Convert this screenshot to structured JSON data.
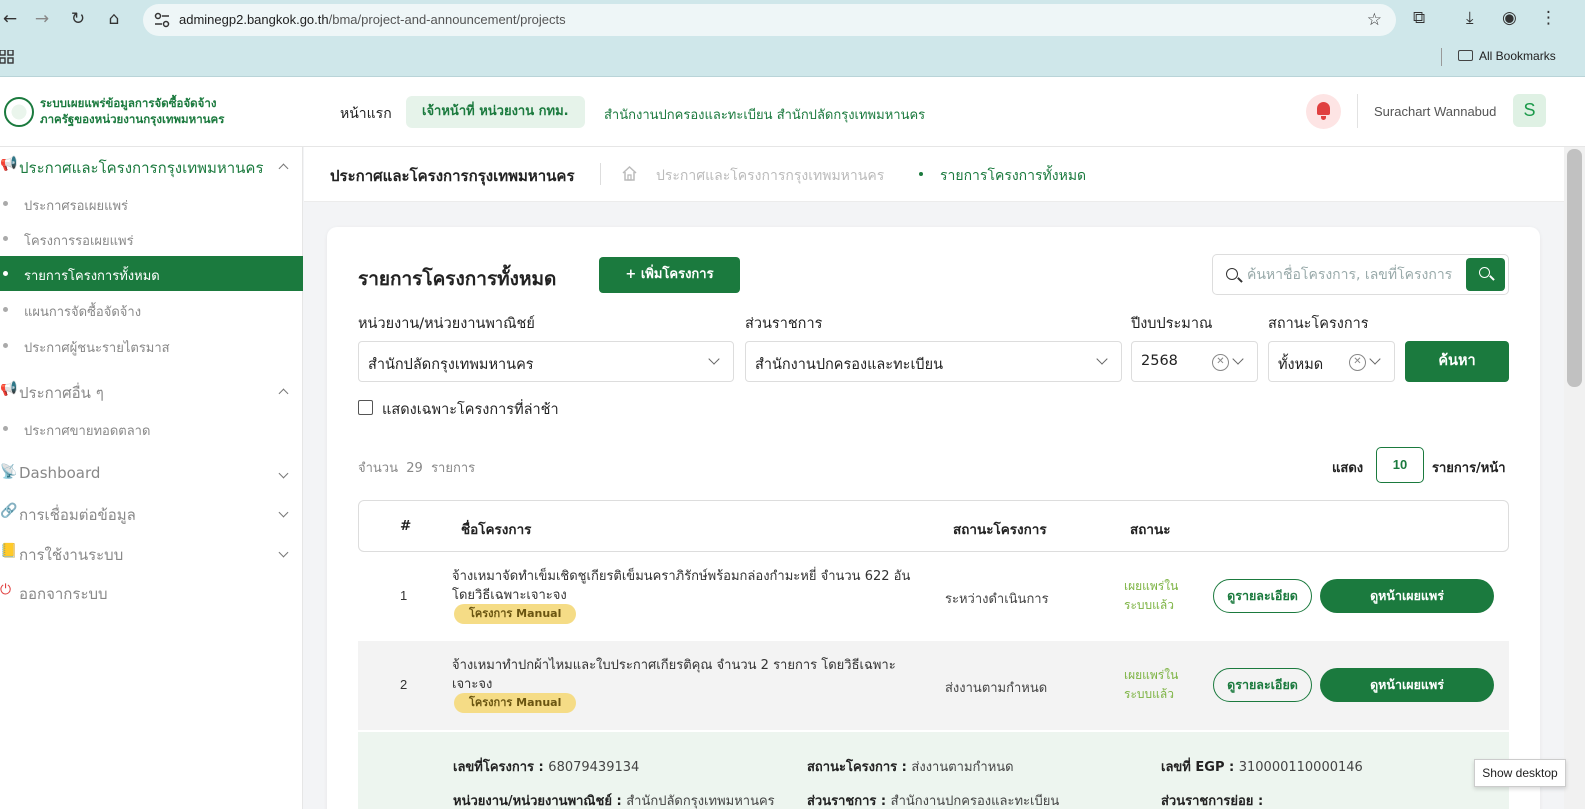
{
  "browser": {
    "url_host": "adminegp2.bangkok.go.th",
    "url_path": "/bma/project-and-announcement/projects",
    "all_bookmarks": "All Bookmarks"
  },
  "header": {
    "logo_line1": "ระบบเผยแพร่ข้อมูลการจัดซื้อจัดจ้าง",
    "logo_line2": "ภาครัฐของหน่วยงานกรุงเทพมหานคร",
    "home": "หน้าแรก",
    "role": "เจ้าหน้าที่ หน่วยงาน กทม.",
    "department": "สำนักงานปกครองและทะเบียน สำนักปลัดกรุงเทพมหานคร",
    "user_name": "Surachart Wannabud",
    "avatar_letter": "S"
  },
  "sidebar": {
    "sections": [
      {
        "icon": "📢",
        "label": "ประกาศและโครงการกรุงเทพมหานคร",
        "items": [
          "ประกาศรอเผยแพร่",
          "โครงการรอเผยแพร่",
          "รายการโครงการทั้งหมด",
          "แผนการจัดซื้อจัดจ้าง",
          "ประกาศผู้ชนะรายไตรมาส"
        ]
      },
      {
        "icon": "📢",
        "label": "ประกาศอื่น ๆ",
        "items": [
          "ประกาศขายทอดตลาด"
        ]
      },
      {
        "icon": "📡",
        "label": "Dashboard"
      },
      {
        "icon": "🔗",
        "label": "การเชื่อมต่อข้อมูล"
      },
      {
        "icon": "📒",
        "label": "การใช้งานระบบ"
      },
      {
        "icon": "⏻",
        "label": "ออกจากระบบ"
      }
    ]
  },
  "page": {
    "title": "ประกาศและโครงการกรุงเทพมหานคร",
    "breadcrumb": [
      "ประกาศและโครงการกรุงเทพมหานคร",
      "รายการโครงการทั้งหมด"
    ]
  },
  "card": {
    "title": "รายการโครงการทั้งหมด",
    "add_button": "+ เพิ่มโครงการ",
    "search_placeholder": "ค้นหาชื่อโครงการ, เลขที่โครงการ",
    "filters": {
      "agency": {
        "label": "หน่วยงาน/หน่วยงานพาณิชย์",
        "value": "สำนักปลัดกรุงเทพมหานคร"
      },
      "division": {
        "label": "ส่วนราชการ",
        "value": "สำนักงานปกครองและทะเบียน"
      },
      "year": {
        "label": "ปีงบประมาณ",
        "value": "2568"
      },
      "status": {
        "label": "สถานะโครงการ",
        "value": "ทั้งหมด"
      },
      "search_button": "ค้นหา",
      "late_only": "แสดงเฉพาะโครงการที่ล่าช้า"
    },
    "count_prefix": "จำนวน",
    "count": "29",
    "count_suffix": "รายการ",
    "show_label": "แสดง",
    "per_page": "10",
    "per_page_unit": "รายการ/หน้า"
  },
  "table": {
    "headers": {
      "num": "#",
      "name": "ชื่อโครงการ",
      "project_status": "สถานะโครงการ",
      "status": "สถานะ"
    },
    "rows": [
      {
        "num": "1",
        "name": "จ้างเหมาจัดทำเข็มเชิดชูเกียรติเข็มนคราภิรักษ์พร้อมกล่องกำมะหยี่ จำนวน 622 อัน โดยวิธีเฉพาะเจาะจง",
        "badge": "โครงการ Manual",
        "project_status": "ระหว่างดำเนินการ",
        "status": "เผยแพร่ในระบบแล้ว",
        "detail": "ดูรายละเอียด",
        "publish": "ดูหน้าเผยแพร่"
      },
      {
        "num": "2",
        "name": "จ้างเหมาทำปกผ้าไหมและใบประกาศเกียรติคุณ จำนวน 2 รายการ โดยวิธีเฉพาะเจาะจง",
        "badge": "โครงการ Manual",
        "project_status": "ส่งงานตามกำหนด",
        "status": "เผยแพร่ในระบบแล้ว",
        "detail": "ดูรายละเอียด",
        "publish": "ดูหน้าเผยแพร่"
      }
    ],
    "expanded": {
      "project_no_label": "เลขที่โครงการ :",
      "project_no": "68079439134",
      "status_label": "สถานะโครงการ :",
      "status": "ส่งงานตามกำหนด",
      "egp_label": "เลขที่ EGP :",
      "egp": "310000110000146",
      "agency_label": "หน่วยงาน/หน่วยงานพาณิชย์ :",
      "agency": "สำนักปลัดกรุงเทพมหานคร",
      "division_label": "ส่วนราชการ :",
      "division": "สำนักงานปกครองและทะเบียน",
      "subdivision_label": "ส่วนราชการย่อย :"
    }
  },
  "tooltip": "Show desktop"
}
